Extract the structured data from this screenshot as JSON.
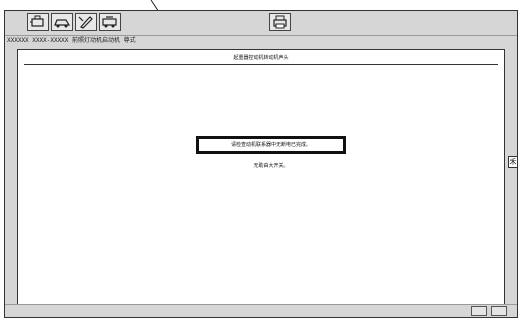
{
  "status_line": "XXXXXX XXXX-XXXXX 前照灯动机启动机 尊式",
  "page_title": "起重器控动机转动机声头",
  "message_box": "请检查动机联系器中无断电已完成。",
  "sub_message": "无助由大开关。",
  "side_button_label": "禾",
  "toolbar": {
    "buttons": [
      "engine-icon",
      "car-icon",
      "tool-icon",
      "vehicle-icon",
      "printer-icon"
    ]
  }
}
